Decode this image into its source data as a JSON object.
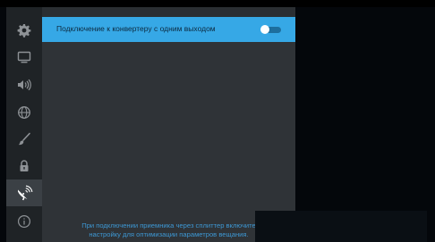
{
  "sidebar": {
    "items": [
      {
        "icon": "gear-icon",
        "active": false
      },
      {
        "icon": "tv-icon",
        "active": false
      },
      {
        "icon": "sound-icon",
        "active": false
      },
      {
        "icon": "globe-icon",
        "active": false
      },
      {
        "icon": "brush-icon",
        "active": false
      },
      {
        "icon": "lock-icon",
        "active": false
      },
      {
        "icon": "satellite-dish-icon",
        "active": true
      },
      {
        "icon": "info-icon",
        "active": false
      }
    ]
  },
  "panel": {
    "option": {
      "label": "Подключение к конвертеру с одним выходом",
      "toggle_on": false
    },
    "hint": {
      "line1": "При подключении приемника через сплиттер включите",
      "line2": "настройку для оптимизации параметров вещания."
    }
  },
  "colors": {
    "accent": "#36a8e6",
    "hint_text": "#3d97d3",
    "sidebar_bg": "#1f2326",
    "panel_bg": "#2f3337",
    "background": "#04070b"
  }
}
